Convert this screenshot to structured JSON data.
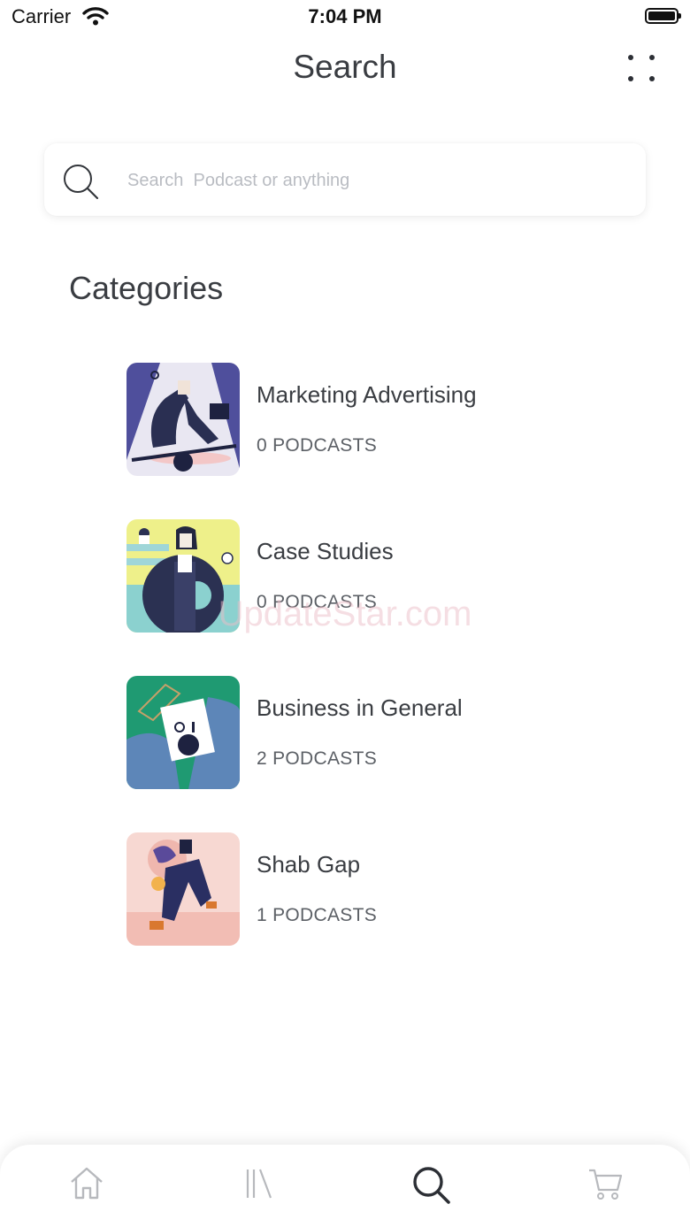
{
  "status_bar": {
    "carrier": "Carrier",
    "time": "7:04 PM"
  },
  "header": {
    "title": "Search",
    "more_icon": "more-dots-icon"
  },
  "search": {
    "placeholder": "Search  Podcast or anything",
    "value": "",
    "icon": "search-icon"
  },
  "categories": {
    "title": "Categories",
    "items": [
      {
        "name": "Marketing Advertising",
        "count": "0 PODCASTS"
      },
      {
        "name": "Case Studies",
        "count": "0 PODCASTS"
      },
      {
        "name": "Business in General",
        "count": "2 PODCASTS"
      },
      {
        "name": "Shab Gap",
        "count": "1 PODCASTS"
      }
    ]
  },
  "watermark": "UpdateStar.com",
  "tab_bar": {
    "active_tab": "search",
    "active_color": "#2c2f35",
    "inactive_color": "#b7b9bd",
    "tabs": [
      {
        "id": "home",
        "icon": "home-icon"
      },
      {
        "id": "library",
        "icon": "library-icon"
      },
      {
        "id": "search",
        "icon": "search-icon"
      },
      {
        "id": "cart",
        "icon": "cart-icon"
      }
    ]
  }
}
